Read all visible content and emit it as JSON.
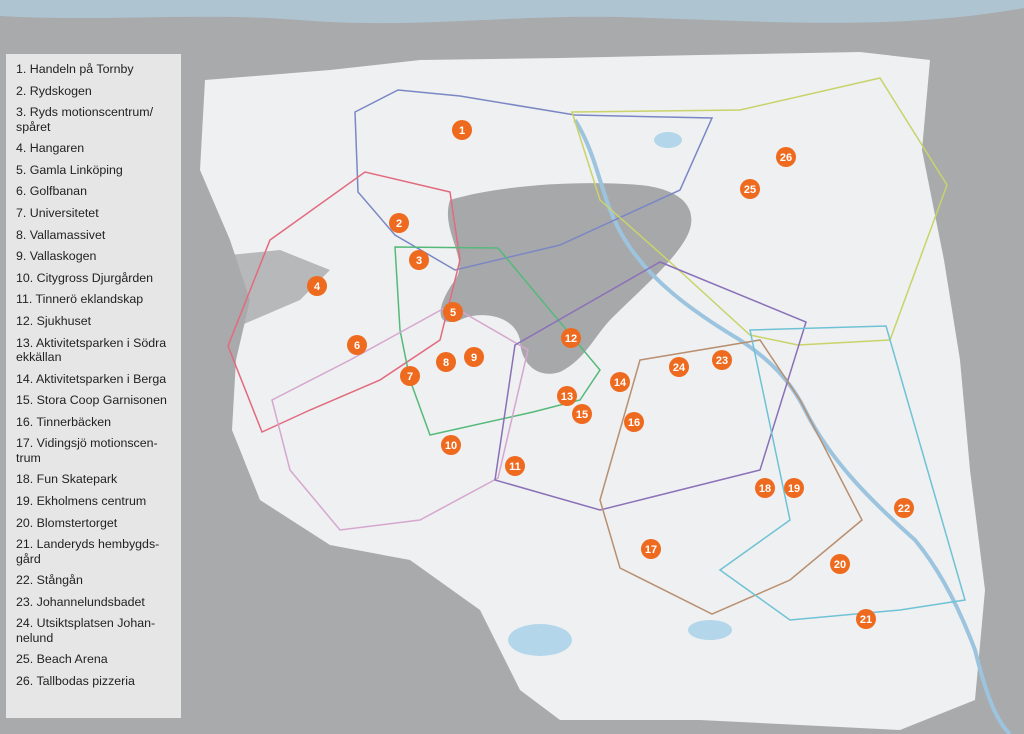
{
  "legend": {
    "items": [
      {
        "number": "1",
        "text": "1. Handeln på Tornby"
      },
      {
        "number": "2",
        "text": "2. Rydskogen"
      },
      {
        "number": "3",
        "text": "3. Ryds motionscentrum/ spåret"
      },
      {
        "number": "4",
        "text": "4. Hangaren"
      },
      {
        "number": "5",
        "text": "5. Gamla Linköping"
      },
      {
        "number": "6",
        "text": "6. Golfbanan"
      },
      {
        "number": "7",
        "text": "7. Universitetet"
      },
      {
        "number": "8",
        "text": "8. Vallamassivet"
      },
      {
        "number": "9",
        "text": "9. Vallaskogen"
      },
      {
        "number": "10",
        "text": "10. Citygross Djurgården"
      },
      {
        "number": "11",
        "text": "11. Tinnerö eklandskap"
      },
      {
        "number": "12",
        "text": "12. Sjukhuset"
      },
      {
        "number": "13",
        "text": "13. Aktivitetsparken i Södra ekkällan"
      },
      {
        "number": "14",
        "text": "14. Aktivitetsparken i Berga"
      },
      {
        "number": "15",
        "text": "15. Stora Coop Garnisonen"
      },
      {
        "number": "16",
        "text": "16. Tinnerbäcken"
      },
      {
        "number": "17",
        "text": "17. Vidingsjö motionscen- trum"
      },
      {
        "number": "18",
        "text": "18. Fun Skatepark"
      },
      {
        "number": "19",
        "text": "19. Ekholmens centrum"
      },
      {
        "number": "20",
        "text": "20. Blomstertorget"
      },
      {
        "number": "21",
        "text": "21. Landeryds hembygds- gård"
      },
      {
        "number": "22",
        "text": "22. Stångån"
      },
      {
        "number": "23",
        "text": "23. Johannelundsbadet"
      },
      {
        "number": "24",
        "text": "24. Utsiktsplatsen Johan- nelund"
      },
      {
        "number": "25",
        "text": "25. Beach Arena"
      },
      {
        "number": "26",
        "text": "26. Tallbodas pizzeria"
      }
    ]
  },
  "colors": {
    "background": "#a9aaac",
    "city_area": "#eef0f1",
    "city_core": "#9a9b9d",
    "water": "#b4d6ea",
    "marker": "#ee6a1f",
    "zone_blue": "#7b87c4",
    "zone_yellow": "#c9d36a",
    "zone_red": "#e36a7e",
    "zone_green": "#55b97a",
    "zone_pink": "#d7a6cf",
    "zone_purple": "#8a70b8",
    "zone_brown": "#b98f70",
    "zone_cyan": "#6fc2d6"
  },
  "map": {
    "markers": [
      {
        "number": "1",
        "text": "1"
      },
      {
        "number": "2",
        "text": "2"
      },
      {
        "number": "3",
        "text": "3"
      },
      {
        "number": "4",
        "text": "4"
      },
      {
        "number": "5",
        "text": "5"
      },
      {
        "number": "6",
        "text": "6"
      },
      {
        "number": "7",
        "text": "7"
      },
      {
        "number": "8",
        "text": "8"
      },
      {
        "number": "9",
        "text": "9"
      },
      {
        "number": "10",
        "text": "10"
      },
      {
        "number": "11",
        "text": "11"
      },
      {
        "number": "12",
        "text": "12"
      },
      {
        "number": "13",
        "text": "13"
      },
      {
        "number": "14",
        "text": "14"
      },
      {
        "number": "15",
        "text": "15"
      },
      {
        "number": "16",
        "text": "16"
      },
      {
        "number": "17",
        "text": "17"
      },
      {
        "number": "18",
        "text": "18"
      },
      {
        "number": "19",
        "text": "19"
      },
      {
        "number": "20",
        "text": "20"
      },
      {
        "number": "21",
        "text": "21"
      },
      {
        "number": "22",
        "text": "22"
      },
      {
        "number": "23",
        "text": "23"
      },
      {
        "number": "24",
        "text": "24"
      },
      {
        "number": "25",
        "text": "25"
      },
      {
        "number": "26",
        "text": "26"
      }
    ]
  }
}
